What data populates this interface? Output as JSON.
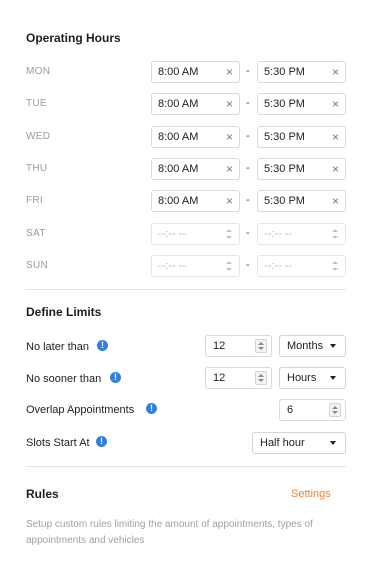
{
  "operating_hours": {
    "title": "Operating Hours",
    "rows": [
      {
        "day": "MON",
        "open": "8:00 AM",
        "close": "5:30 PM",
        "enabled": true
      },
      {
        "day": "TUE",
        "open": "8:00 AM",
        "close": "5:30 PM",
        "enabled": true
      },
      {
        "day": "WED",
        "open": "8:00 AM",
        "close": "5:30 PM",
        "enabled": true
      },
      {
        "day": "THU",
        "open": "8:00 AM",
        "close": "5:30 PM",
        "enabled": true
      },
      {
        "day": "FRI",
        "open": "8:00 AM",
        "close": "5:30 PM",
        "enabled": true
      },
      {
        "day": "SAT",
        "open": "--:-- --",
        "close": "--:-- --",
        "enabled": false
      },
      {
        "day": "SUN",
        "open": "--:-- --",
        "close": "--:-- --",
        "enabled": false
      }
    ],
    "separator": "-",
    "clear_glyph": "×"
  },
  "define_limits": {
    "title": "Define Limits",
    "info_glyph": "!",
    "no_later_than": {
      "label": "No later than",
      "value": "12",
      "unit": "Months"
    },
    "no_sooner_than": {
      "label": "No sooner than",
      "value": "12",
      "unit": "Hours"
    },
    "overlap": {
      "label": "Overlap Appointments",
      "value": "6"
    },
    "slots_start": {
      "label": "Slots Start At",
      "value": "Half hour"
    }
  },
  "rules": {
    "title": "Rules",
    "settings_link": "Settings",
    "description": "Setup custom rules limiting the amount of appointments, types of appointments and vehicles"
  },
  "colors": {
    "accent_info": "#2f7fe0",
    "settings_link": "#e8833a"
  }
}
